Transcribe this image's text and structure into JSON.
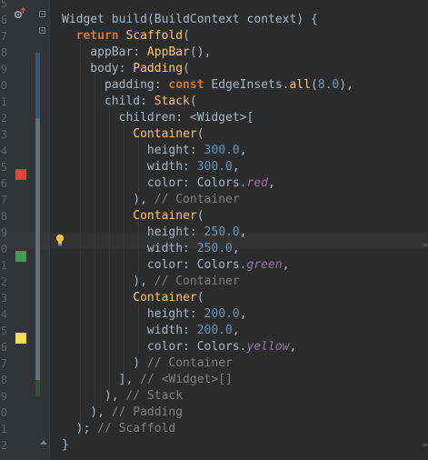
{
  "editor": {
    "language": "dart",
    "colors": {
      "keyword": "#cc7832",
      "class": "#ffc66d",
      "number": "#6897bb",
      "comment": "#808080",
      "plain": "#a9b7c6",
      "italic_field": "#9876aa"
    },
    "swatches": {
      "red": "#e5413b",
      "green": "#3d9e4f",
      "yellow": "#f4e04b"
    },
    "line_numbers": [
      "5",
      "6",
      "7",
      "8",
      "9",
      "0",
      "1",
      "2",
      "3",
      "4",
      "5",
      "6",
      "7",
      "8",
      "9",
      "0",
      "1",
      "2",
      "3",
      "4",
      "5",
      "6",
      "7",
      "8",
      "9",
      "0",
      "1",
      "2"
    ],
    "lines": [
      {
        "tokens": [
          {
            "t": "",
            "c": "plain"
          }
        ]
      },
      {
        "tokens": [
          {
            "t": "Widget ",
            "c": "plain"
          },
          {
            "t": "build",
            "c": "plain"
          },
          {
            "t": "(BuildContext context) {",
            "c": "plain"
          }
        ]
      },
      {
        "tokens": [
          {
            "t": "  ",
            "c": "plain"
          },
          {
            "t": "return ",
            "c": "kw"
          },
          {
            "t": "Scaffold",
            "c": "cls"
          },
          {
            "t": "(",
            "c": "plain"
          }
        ]
      },
      {
        "tokens": [
          {
            "t": "    appBar: ",
            "c": "plain"
          },
          {
            "t": "AppBar",
            "c": "cls"
          },
          {
            "t": "(),",
            "c": "plain"
          }
        ]
      },
      {
        "tokens": [
          {
            "t": "    body: ",
            "c": "plain"
          },
          {
            "t": "Padding",
            "c": "cls"
          },
          {
            "t": "(",
            "c": "plain"
          }
        ]
      },
      {
        "tokens": [
          {
            "t": "      padding: ",
            "c": "plain"
          },
          {
            "t": "const ",
            "c": "kw"
          },
          {
            "t": "EdgeInsets.",
            "c": "plain"
          },
          {
            "t": "all",
            "c": "cls"
          },
          {
            "t": "(",
            "c": "plain"
          },
          {
            "t": "8.0",
            "c": "num"
          },
          {
            "t": "),",
            "c": "plain"
          }
        ]
      },
      {
        "tokens": [
          {
            "t": "      child: ",
            "c": "plain"
          },
          {
            "t": "Stack",
            "c": "cls"
          },
          {
            "t": "(",
            "c": "plain"
          }
        ]
      },
      {
        "tokens": [
          {
            "t": "        children: <Widget>[",
            "c": "plain"
          }
        ]
      },
      {
        "tokens": [
          {
            "t": "          ",
            "c": "plain"
          },
          {
            "t": "Container",
            "c": "cls"
          },
          {
            "t": "(",
            "c": "plain"
          }
        ]
      },
      {
        "tokens": [
          {
            "t": "            height: ",
            "c": "plain"
          },
          {
            "t": "300.0",
            "c": "num"
          },
          {
            "t": ",",
            "c": "plain"
          }
        ]
      },
      {
        "tokens": [
          {
            "t": "            width: ",
            "c": "plain"
          },
          {
            "t": "300.0",
            "c": "num"
          },
          {
            "t": ",",
            "c": "plain"
          }
        ]
      },
      {
        "tokens": [
          {
            "t": "            color: Colors.",
            "c": "plain"
          },
          {
            "t": "red",
            "c": "ital"
          },
          {
            "t": ",",
            "c": "plain"
          }
        ]
      },
      {
        "tokens": [
          {
            "t": "          ), ",
            "c": "plain"
          },
          {
            "t": "// Container",
            "c": "cmt"
          }
        ]
      },
      {
        "tokens": [
          {
            "t": "          ",
            "c": "plain"
          },
          {
            "t": "Container",
            "c": "cls"
          },
          {
            "t": "(",
            "c": "plain"
          }
        ]
      },
      {
        "tokens": [
          {
            "t": "            height: ",
            "c": "plain"
          },
          {
            "t": "250.0",
            "c": "num"
          },
          {
            "t": ",",
            "c": "plain"
          }
        ]
      },
      {
        "tokens": [
          {
            "t": "            width: ",
            "c": "plain"
          },
          {
            "t": "250.0",
            "c": "num"
          },
          {
            "t": ",",
            "c": "plain"
          }
        ]
      },
      {
        "tokens": [
          {
            "t": "            color: Colors.",
            "c": "plain"
          },
          {
            "t": "green",
            "c": "ital"
          },
          {
            "t": ",",
            "c": "plain"
          }
        ]
      },
      {
        "tokens": [
          {
            "t": "          ), ",
            "c": "plain"
          },
          {
            "t": "// Container",
            "c": "cmt"
          }
        ]
      },
      {
        "tokens": [
          {
            "t": "          ",
            "c": "plain"
          },
          {
            "t": "Container",
            "c": "cls"
          },
          {
            "t": "(",
            "c": "plain"
          }
        ]
      },
      {
        "tokens": [
          {
            "t": "            height: ",
            "c": "plain"
          },
          {
            "t": "200.0",
            "c": "num"
          },
          {
            "t": ",",
            "c": "plain"
          }
        ]
      },
      {
        "tokens": [
          {
            "t": "            width: ",
            "c": "plain"
          },
          {
            "t": "200.0",
            "c": "num"
          },
          {
            "t": ",",
            "c": "plain"
          }
        ]
      },
      {
        "tokens": [
          {
            "t": "            color: Colors.",
            "c": "plain"
          },
          {
            "t": "yellow",
            "c": "ital"
          },
          {
            "t": ",",
            "c": "plain"
          }
        ]
      },
      {
        "tokens": [
          {
            "t": "          ) ",
            "c": "plain"
          },
          {
            "t": "// Container",
            "c": "cmt"
          }
        ]
      },
      {
        "tokens": [
          {
            "t": "        ], ",
            "c": "plain"
          },
          {
            "t": "// <Widget>[]",
            "c": "cmt"
          }
        ]
      },
      {
        "tokens": [
          {
            "t": "      ), ",
            "c": "plain"
          },
          {
            "t": "// Stack",
            "c": "cmt"
          }
        ]
      },
      {
        "tokens": [
          {
            "t": "    ), ",
            "c": "plain"
          },
          {
            "t": "// Padding",
            "c": "cmt"
          }
        ]
      },
      {
        "tokens": [
          {
            "t": "  ); ",
            "c": "plain"
          },
          {
            "t": "// Scaffold",
            "c": "cmt"
          }
        ]
      },
      {
        "tokens": [
          {
            "t": "}",
            "c": "plain"
          }
        ]
      }
    ]
  }
}
